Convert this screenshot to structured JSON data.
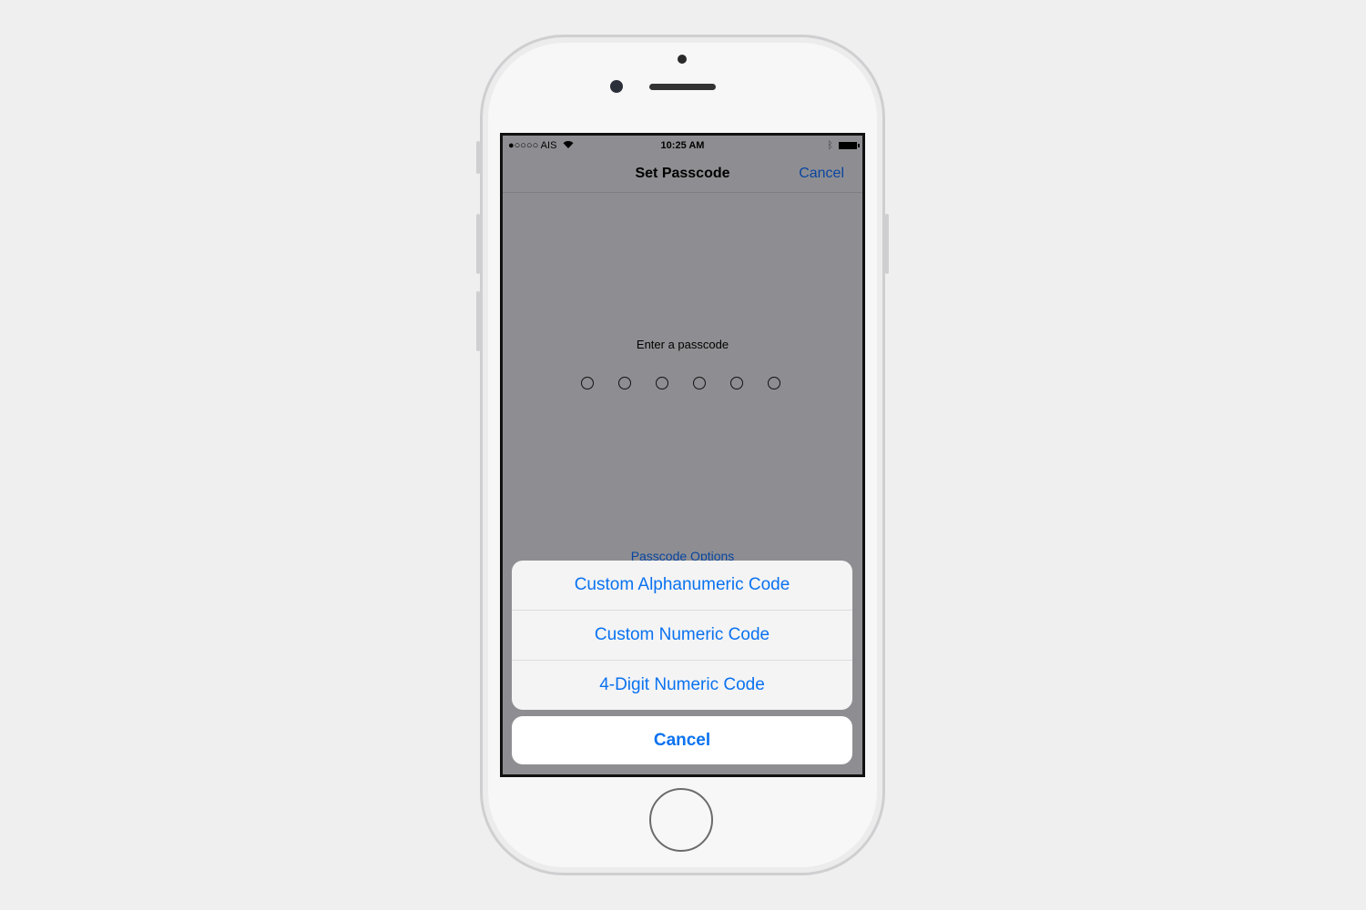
{
  "status": {
    "carrier": "●○○○○ AIS",
    "time": "10:25 AM",
    "bluetooth": "bluetooth-icon",
    "wifi": "wifi-icon",
    "battery": "battery-icon"
  },
  "nav": {
    "title": "Set Passcode",
    "cancel": "Cancel"
  },
  "main": {
    "prompt": "Enter a passcode",
    "digits": 6,
    "options": "Passcode Options"
  },
  "sheet": {
    "items": [
      "Custom Alphanumeric Code",
      "Custom Numeric Code",
      "4-Digit Numeric Code"
    ],
    "cancel": "Cancel"
  },
  "colors": {
    "accent": "#0a72f0",
    "nav_link": "#0a45a0",
    "dim_bg": "#8e8e92"
  }
}
